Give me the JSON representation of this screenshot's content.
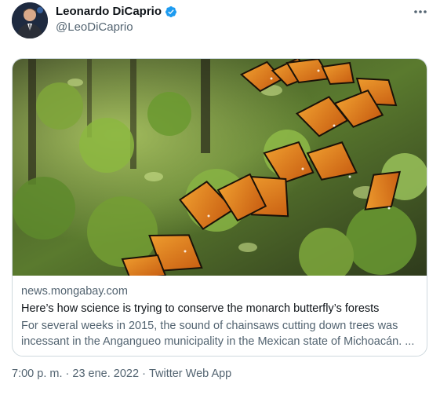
{
  "author": {
    "display_name": "Leonardo DiCaprio",
    "handle": "@LeoDiCaprio",
    "verified_icon": "verified-badge-icon",
    "avatar_icon": "profile-photo"
  },
  "menu": {
    "icon": "more-options-icon"
  },
  "card": {
    "domain": "news.mongabay.com",
    "title": "Here’s how science is trying to conserve the monarch butterfly’s forests",
    "description_line1": "For several weeks in 2015, the sound of chainsaws cutting down trees was",
    "description_line2": "incessant in the Angangueo municipality in the Mexican state of Michoacán. ...",
    "image": "monarch-butterflies-photo"
  },
  "meta": {
    "time": "7:00 p. m.",
    "separator": " · ",
    "date": "23 ene. 2022",
    "source": "Twitter Web App"
  },
  "colors": {
    "primary_text": "#0f1419",
    "secondary_text": "#536471",
    "verified_blue": "#1d9bf0",
    "card_border": "#cfd9de"
  }
}
